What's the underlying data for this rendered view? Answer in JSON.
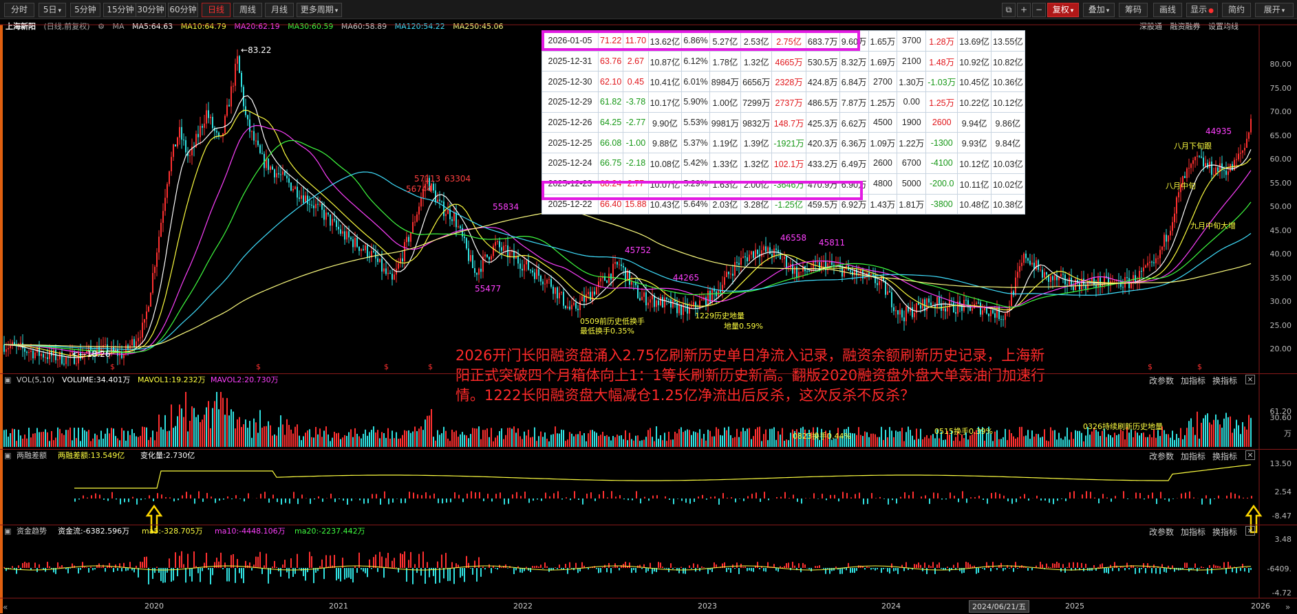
{
  "toolbar": {
    "periods": [
      {
        "label": "分时",
        "active": false
      },
      {
        "label": "5日",
        "active": false,
        "dropdown": true
      },
      {
        "label": "5分钟",
        "active": false
      },
      {
        "label": "15分钟",
        "active": false
      },
      {
        "label": "30分钟",
        "active": false
      },
      {
        "label": "60分钟",
        "active": false
      },
      {
        "label": "日线",
        "active": true
      },
      {
        "label": "周线",
        "active": false
      },
      {
        "label": "月线",
        "active": false
      },
      {
        "label": "更多周期",
        "active": false,
        "dropdown": true
      }
    ],
    "right_buttons": [
      {
        "label": "复权",
        "dropdown": true,
        "highlight": true
      },
      {
        "label": "叠加",
        "dropdown": true
      },
      {
        "label": "筹码"
      },
      {
        "label": "画线"
      },
      {
        "label": "显示",
        "dropdown": true
      },
      {
        "label": "简约"
      },
      {
        "label": "展开",
        "dropdown": true
      }
    ],
    "icons": [
      "window-icon",
      "plus-icon",
      "minus-icon"
    ]
  },
  "main_panel": {
    "stock_name": "上海新阳",
    "mode": "(日线,前复权)",
    "ma_label": "MA",
    "mas": [
      {
        "text": "MA5:64.63",
        "color": "#ffffff"
      },
      {
        "text": "MA10:64.79",
        "color": "#ffff40"
      },
      {
        "text": "MA20:62.19",
        "color": "#ff40ff"
      },
      {
        "text": "MA30:60.59",
        "color": "#40ff40"
      },
      {
        "text": "MA60:58.89",
        "color": "#d0d0d0"
      },
      {
        "text": "MA120:54.22",
        "color": "#40e0ff"
      },
      {
        "text": "MA250:45.06",
        "color": "#ffff80"
      }
    ],
    "top_right_links": [
      "深股通",
      "融资融券",
      "设置均线"
    ],
    "y_axis": [
      "80.00",
      "75.00",
      "70.00",
      "65.00",
      "60.00",
      "55.00",
      "50.00",
      "45.00",
      "40.00",
      "35.00",
      "30.00",
      "25.00",
      "20.00"
    ],
    "high_label": "83.22",
    "low_label": "18.26",
    "note": "2026开门长阳融资盘涌入2.75亿刷新历史单日净流入记录，融资余额刷新历史记录，上海新阳正式突破四个月箱体向上1：1等长刷新历史新高。翻版2020融资盘外盘大单轰油门加速行情。1222长阳融资盘大幅减仓1.25亿净流出后反杀，这次反杀不反杀？",
    "annotations": [
      {
        "text": "57113",
        "color": "#ff4040"
      },
      {
        "text": "63304",
        "color": "#ff4040"
      },
      {
        "text": "56744",
        "color": "#ff4040"
      },
      {
        "text": "55834",
        "color": "#ff40ff"
      },
      {
        "text": "55477",
        "color": "#ff40ff"
      },
      {
        "text": "45752",
        "color": "#ff40ff"
      },
      {
        "text": "44265",
        "color": "#ff40ff"
      },
      {
        "text": "45811",
        "color": "#ff40ff"
      },
      {
        "text": "46558",
        "color": "#ff40ff"
      },
      {
        "text": "44935",
        "color": "#ff40ff"
      },
      {
        "text": "0509前历史低换手",
        "color": "#ffff40"
      },
      {
        "text": "最低换手0.35%",
        "color": "#ffff40"
      },
      {
        "text": "1229历史地量",
        "color": "#ffff40"
      },
      {
        "text": "地量0.59%",
        "color": "#ffff40"
      },
      {
        "text": "八月下旬跟",
        "color": "#ffff40"
      },
      {
        "text": "八月中旬",
        "color": "#ffff40"
      },
      {
        "text": "九月中旬大增",
        "color": "#ffff40"
      }
    ]
  },
  "data_table": {
    "rows": [
      {
        "cells": [
          "2026-01-05",
          "71.22",
          "11.70",
          "13.62亿",
          "6.86%",
          "5.27亿",
          "2.53亿",
          "2.75亿",
          "683.7万",
          "9.60万",
          "1.65万",
          "3700",
          "1.28万",
          "13.69亿",
          "13.55亿"
        ],
        "cls": [
          "",
          "up",
          "up",
          "",
          "",
          "",
          "",
          "up",
          "",
          "",
          "",
          "",
          "up",
          "",
          ""
        ],
        "highlight": true
      },
      {
        "cells": [
          "2025-12-31",
          "63.76",
          "2.67",
          "10.87亿",
          "6.12%",
          "1.78亿",
          "1.32亿",
          "4665万",
          "530.5万",
          "8.32万",
          "1.69万",
          "2100",
          "1.48万",
          "10.92亿",
          "10.82亿"
        ],
        "cls": [
          "",
          "up",
          "up",
          "",
          "",
          "",
          "",
          "up",
          "",
          "",
          "",
          "",
          "up",
          "",
          ""
        ]
      },
      {
        "cells": [
          "2025-12-30",
          "62.10",
          "0.45",
          "10.41亿",
          "6.01%",
          "8984万",
          "6656万",
          "2328万",
          "424.8万",
          "6.84万",
          "2700",
          "1.30万",
          "-1.03万",
          "10.45亿",
          "10.36亿"
        ],
        "cls": [
          "",
          "up",
          "up",
          "",
          "",
          "",
          "",
          "up",
          "",
          "",
          "",
          "",
          "dn",
          "",
          ""
        ]
      },
      {
        "cells": [
          "2025-12-29",
          "61.82",
          "-3.78",
          "10.17亿",
          "5.90%",
          "1.00亿",
          "7299万",
          "2737万",
          "486.5万",
          "7.87万",
          "1.25万",
          "0.00",
          "1.25万",
          "10.22亿",
          "10.12亿"
        ],
        "cls": [
          "",
          "dn",
          "dn",
          "",
          "",
          "",
          "",
          "up",
          "",
          "",
          "",
          "",
          "up",
          "",
          ""
        ]
      },
      {
        "cells": [
          "2025-12-26",
          "64.25",
          "-2.77",
          "9.90亿",
          "5.53%",
          "9981万",
          "9832万",
          "148.7万",
          "425.3万",
          "6.62万",
          "4500",
          "1900",
          "2600",
          "9.94亿",
          "9.86亿"
        ],
        "cls": [
          "",
          "dn",
          "dn",
          "",
          "",
          "",
          "",
          "up",
          "",
          "",
          "",
          "",
          "up",
          "",
          ""
        ]
      },
      {
        "cells": [
          "2025-12-25",
          "66.08",
          "-1.00",
          "9.88亿",
          "5.37%",
          "1.19亿",
          "1.39亿",
          "-1921万",
          "420.3万",
          "6.36万",
          "1.09万",
          "1.22万",
          "-1300",
          "9.93亿",
          "9.84亿"
        ],
        "cls": [
          "",
          "dn",
          "dn",
          "",
          "",
          "",
          "",
          "dn",
          "",
          "",
          "",
          "",
          "dn",
          "",
          ""
        ]
      },
      {
        "cells": [
          "2025-12-24",
          "66.75",
          "-2.18",
          "10.08亿",
          "5.42%",
          "1.33亿",
          "1.32亿",
          "102.1万",
          "433.2万",
          "6.49万",
          "2600",
          "6700",
          "-4100",
          "10.12亿",
          "10.03亿"
        ],
        "cls": [
          "",
          "dn",
          "dn",
          "",
          "",
          "",
          "",
          "up",
          "",
          "",
          "",
          "",
          "dn",
          "",
          ""
        ]
      },
      {
        "cells": [
          "2025-12-23",
          "68.24",
          "2.77",
          "10.07亿",
          "5.29%",
          "1.63亿",
          "2.00亿",
          "-3646万",
          "470.9万",
          "6.90万",
          "4800",
          "5000",
          "-200.0",
          "10.11亿",
          "10.02亿"
        ],
        "cls": [
          "",
          "up",
          "up",
          "",
          "",
          "",
          "",
          "dn",
          "",
          "",
          "",
          "",
          "dn",
          "",
          ""
        ]
      },
      {
        "cells": [
          "2025-12-22",
          "66.40",
          "15.88",
          "10.43亿",
          "5.64%",
          "2.03亿",
          "3.28亿",
          "-1.25亿",
          "459.5万",
          "6.92万",
          "1.43万",
          "1.81万",
          "-3800",
          "10.48亿",
          "10.38亿"
        ],
        "cls": [
          "",
          "up",
          "up",
          "",
          "",
          "",
          "",
          "dn",
          "",
          "",
          "",
          "",
          "dn",
          "",
          ""
        ],
        "highlight": true
      }
    ]
  },
  "vol_panel": {
    "title": "VOL(5,10)",
    "items": [
      {
        "text": "VOLUME:34.401万",
        "color": "#ffffff"
      },
      {
        "text": "MAVOL1:19.232万",
        "color": "#ffff40"
      },
      {
        "text": "MAVOL2:20.730万",
        "color": "#ff40ff"
      }
    ],
    "y_axis": [
      "61.20",
      "30.60",
      "万"
    ],
    "buttons": [
      "改参数",
      "加指标",
      "换指标"
    ],
    "annotations": [
      "0823换手0.44%",
      "0515换手0.39%",
      "0326持续刷新历史地量"
    ]
  },
  "margin_panel": {
    "title": "两融差额",
    "items": [
      {
        "text": "两融差额:13.549亿",
        "color": "#ffff40"
      },
      {
        "text": "变化量:2.730亿",
        "color": "#ffffff"
      }
    ],
    "y_axis": [
      "13.50",
      "2.54",
      "-8.47"
    ],
    "buttons": [
      "改参数",
      "加指标",
      "换指标"
    ]
  },
  "fund_panel": {
    "title": "资金趋势",
    "items": [
      {
        "text": "资金流:-6382.596万",
        "color": "#ffffff"
      },
      {
        "text": "ma5:-328.705万",
        "color": "#ffff40"
      },
      {
        "text": "ma10:-4448.106万",
        "color": "#ff40ff"
      },
      {
        "text": "ma20:-2237.442万",
        "color": "#40ff40"
      }
    ],
    "y_axis": [
      "3.48",
      "-6409.",
      "-4.72"
    ],
    "buttons": [
      "改参数",
      "加指标",
      "换指标"
    ]
  },
  "x_axis": {
    "years": [
      "2020",
      "2021",
      "2022",
      "2023",
      "2024",
      "2025",
      "2026"
    ],
    "cursor_date": "2024/06/21/五"
  }
}
